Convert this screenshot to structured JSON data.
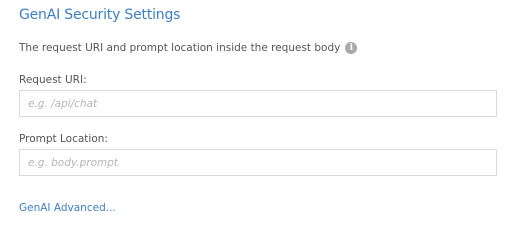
{
  "section": {
    "title": "GenAI Security Settings",
    "description": "The request URI and prompt location inside the request body",
    "info_icon": "info-icon"
  },
  "fields": {
    "request_uri": {
      "label": "Request URI:",
      "value": "",
      "placeholder": "e.g. /api/chat"
    },
    "prompt_location": {
      "label": "Prompt Location:",
      "value": "",
      "placeholder": "e.g. body.prompt"
    }
  },
  "advanced_link": "GenAI Advanced...",
  "colors": {
    "accent": "#3b7fc4",
    "text": "#555555",
    "placeholder": "#b5b5b5",
    "border": "#d9d9d9",
    "icon": "#a9a9a9"
  }
}
